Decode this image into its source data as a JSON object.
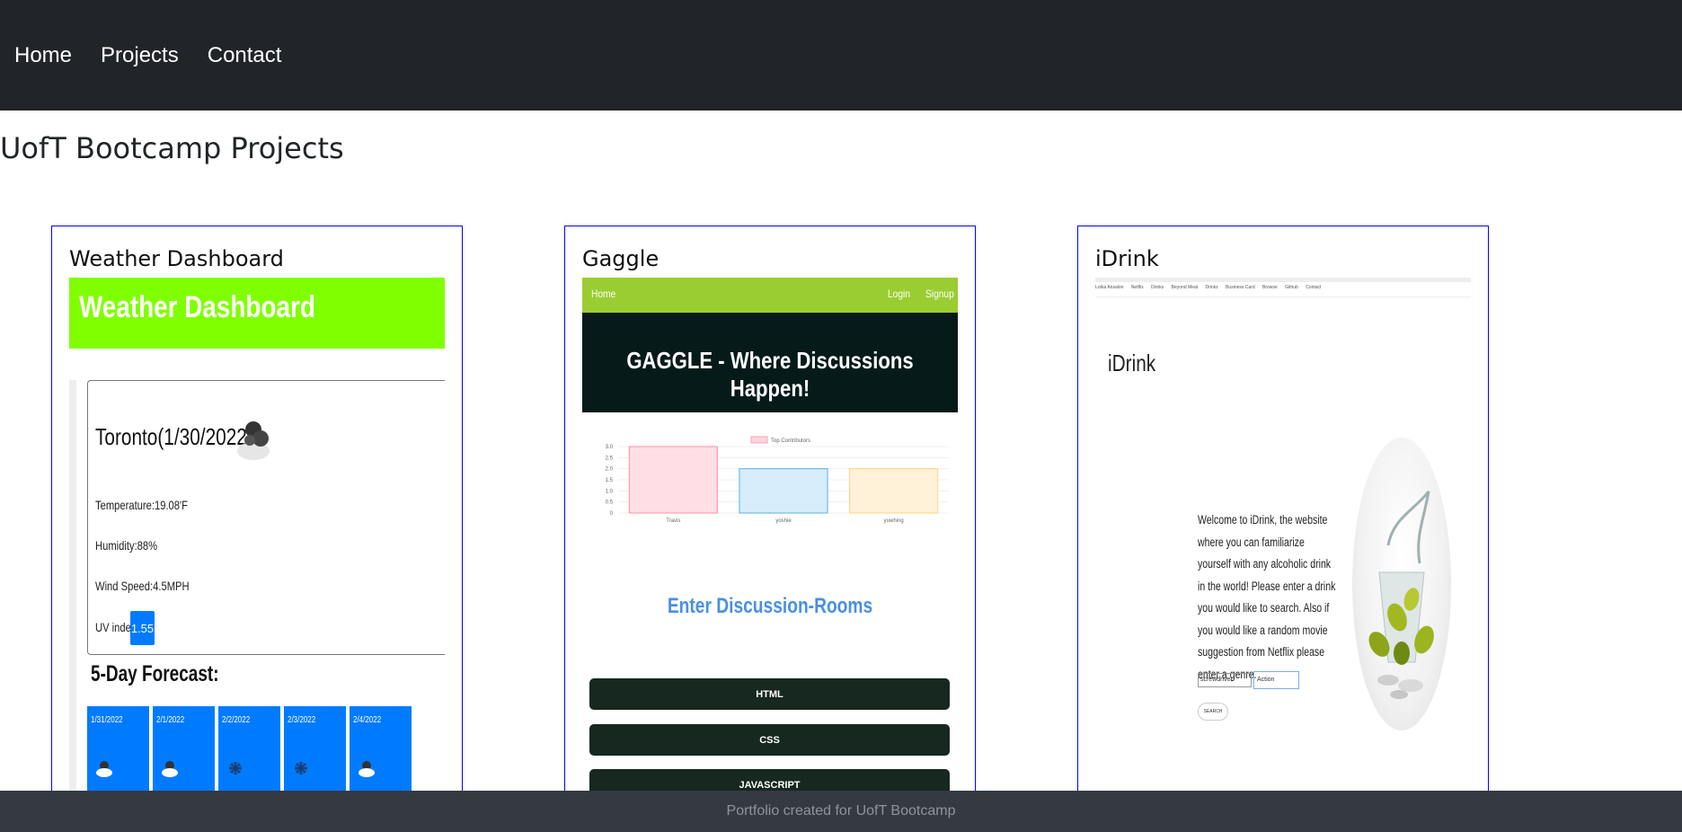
{
  "nav": {
    "items": [
      "Home",
      "Projects",
      "Contact"
    ]
  },
  "page": {
    "title": "UofT Bootcamp Projects"
  },
  "projects": {
    "weather": {
      "title": "Weather Dashboard",
      "shot": {
        "banner": "Weather Dashboard",
        "city": "Toronto(1/30/2022)",
        "temperature": "Temperature:19.08'F",
        "humidity": "Humidity:88%",
        "wind": "Wind Speed:4.5MPH",
        "uv_label": "UV index:",
        "uv_value": "1.55",
        "forecast_title": "5-Day Forecast:",
        "days": [
          "1/31/2022",
          "2/1/2022",
          "2/2/2022",
          "2/3/2022",
          "2/4/2022"
        ]
      }
    },
    "gaggle": {
      "title": "Gaggle",
      "shot": {
        "nav_home": "Home",
        "nav_login": "Login",
        "nav_signup": "Signup",
        "hero": "GAGGLE - Where Discussions Happen!",
        "legend": "Top Contributors",
        "chart_categories": [
          "Travis",
          "yoshie",
          "yuwhing"
        ],
        "chart_values": [
          3,
          2,
          2
        ],
        "chart_ticks": [
          "3.0",
          "2.5",
          "2.0",
          "1.5",
          "1.0",
          "0.5",
          "0"
        ],
        "enter": "Enter Discussion-Rooms",
        "buttons": [
          "HTML",
          "CSS",
          "JAVASCRIPT"
        ]
      }
    },
    "idrink": {
      "title": "iDrink",
      "shot": {
        "nav_items": [
          "Lotka Ansalon",
          "Netflix",
          "Drinks",
          "Beyond Meat",
          "Drinkz",
          "Business Card",
          "Browse",
          "Github",
          "Contact"
        ],
        "title": "iDrink",
        "intro": "Welcome to iDrink, the website where you can familiarize yourself with any alcoholic drink in the world! Please enter a drink you would like to search. Also if you would like a random movie suggestion from Netflix please enter a genre.",
        "input_value": "screwdriver",
        "select_value": "Action",
        "search_button": "SEARCH"
      }
    }
  },
  "footer": {
    "text": "Portfolio created for UofT Bootcamp"
  }
}
